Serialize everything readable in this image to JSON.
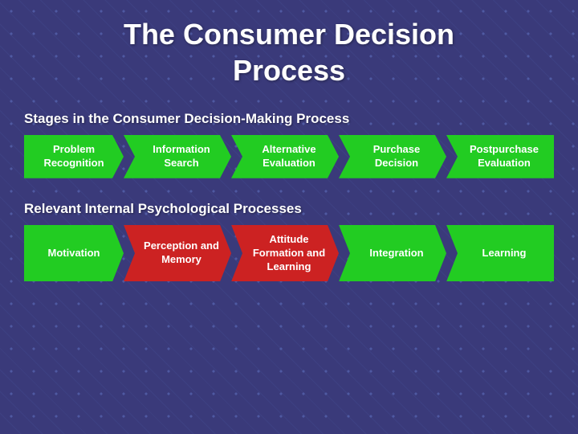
{
  "title": {
    "line1": "The Consumer Decision",
    "line2": "Process"
  },
  "stages_section": {
    "label": "Stages in the Consumer Decision-Making Process",
    "items": [
      {
        "id": "problem-recognition",
        "text": "Problem Recognition",
        "color": "green"
      },
      {
        "id": "information-search",
        "text": "Information Search",
        "color": "green"
      },
      {
        "id": "alternative-evaluation",
        "text": "Alternative Evaluation",
        "color": "green"
      },
      {
        "id": "purchase-decision",
        "text": "Purchase Decision",
        "color": "green"
      },
      {
        "id": "postpurchase-evaluation",
        "text": "Postpurchase Evaluation",
        "color": "green"
      }
    ]
  },
  "psych_section": {
    "label": "Relevant Internal Psychological Processes",
    "items": [
      {
        "id": "motivation",
        "text": "Motivation",
        "color": "green"
      },
      {
        "id": "perception-memory",
        "text": "Perception and Memory",
        "color": "red"
      },
      {
        "id": "attitude-formation",
        "text": "Attitude Formation and Learning",
        "color": "red"
      },
      {
        "id": "integration",
        "text": "Integration",
        "color": "green"
      },
      {
        "id": "learning",
        "text": "Learning",
        "color": "green"
      }
    ]
  }
}
